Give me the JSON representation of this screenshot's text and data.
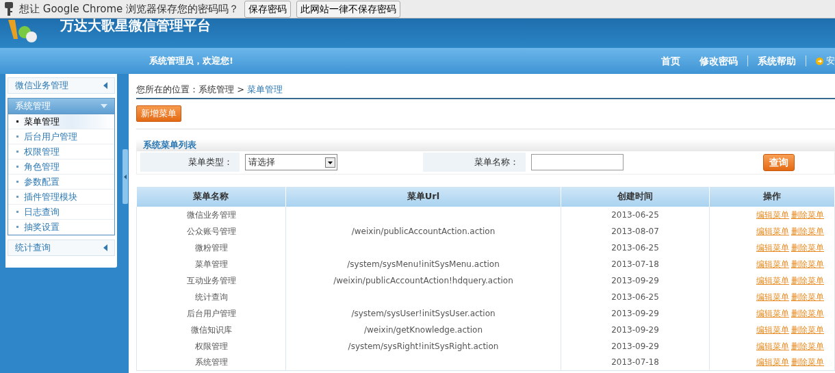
{
  "password_bar": {
    "prompt": "想让 Google Chrome 浏览器保存您的密码吗？",
    "buttons": [
      "保存密码",
      "此网站一律不保存密码"
    ]
  },
  "header": {
    "title": "万达大歌星微信管理平台"
  },
  "nav": {
    "welcome": "系统管理员，欢迎您!",
    "links": [
      "首页",
      "修改密码",
      "系统帮助"
    ],
    "logout": "安"
  },
  "sidebar": [
    {
      "label": "微信业务管理",
      "expanded": false
    },
    {
      "label": "系统管理",
      "expanded": true,
      "children": [
        {
          "label": "菜单管理",
          "selected": true
        },
        {
          "label": "后台用户管理",
          "selected": false
        },
        {
          "label": "权限管理",
          "selected": false
        },
        {
          "label": "角色管理",
          "selected": false
        },
        {
          "label": "参数配置",
          "selected": false
        },
        {
          "label": "插件管理模块",
          "selected": false
        },
        {
          "label": "日志查询",
          "selected": false
        },
        {
          "label": "抽奖设置",
          "selected": false
        }
      ]
    },
    {
      "label": "统计查询",
      "expanded": false
    }
  ],
  "breadcrumb": {
    "path": "您所在的位置：系统管理 >",
    "current": "菜单管理"
  },
  "add_button": "新增菜单",
  "panel": {
    "title": "系统菜单列表",
    "filters": [
      {
        "kind": "select",
        "label": "菜单类型：",
        "value": "请选择"
      },
      {
        "kind": "text",
        "label": "菜单名称："
      }
    ],
    "search_button": "查询"
  },
  "table": {
    "columns": [
      "菜单名称",
      "菜单Url",
      "创建时间",
      "操作"
    ],
    "rows": [
      {
        "name": "微信业务管理",
        "created": "2013-06-25",
        "actions": [
          "编辑菜单",
          "删除菜单"
        ]
      },
      {
        "name": "公众账号管理",
        "url": "/weixin/publicAccountAction.action",
        "created": "2013-08-07",
        "actions": [
          "编辑菜单",
          "删除菜单"
        ]
      },
      {
        "name": "微粉管理",
        "created": "2013-06-25",
        "actions": [
          "编辑菜单",
          "删除菜单"
        ]
      },
      {
        "name": "菜单管理",
        "url": "/system/sysMenu!initSysMenu.action",
        "created": "2013-07-18",
        "actions": [
          "编辑菜单",
          "删除菜单"
        ]
      },
      {
        "name": "互动业务管理",
        "url": "/weixin/publicAccountAction!hdquery.action",
        "created": "2013-09-29",
        "actions": [
          "编辑菜单",
          "删除菜单"
        ]
      },
      {
        "name": "统计查询",
        "created": "2013-06-25",
        "actions": [
          "编辑菜单",
          "删除菜单"
        ]
      },
      {
        "name": "后台用户管理",
        "url": "/system/sysUser!initSysUser.action",
        "created": "2013-09-29",
        "actions": [
          "编辑菜单",
          "删除菜单"
        ]
      },
      {
        "name": "微信知识库",
        "url": "/weixin/getKnowledge.action",
        "created": "2013-09-29",
        "actions": [
          "编辑菜单",
          "删除菜单"
        ]
      },
      {
        "name": "权限管理",
        "url": "/system/sysRight!initSysRight.action",
        "created": "2013-09-29",
        "actions": [
          "编辑菜单",
          "删除菜单"
        ]
      },
      {
        "name": "系统管理",
        "created": "2013-07-18",
        "actions": [
          "编辑菜单",
          "删除菜单"
        ]
      }
    ]
  }
}
